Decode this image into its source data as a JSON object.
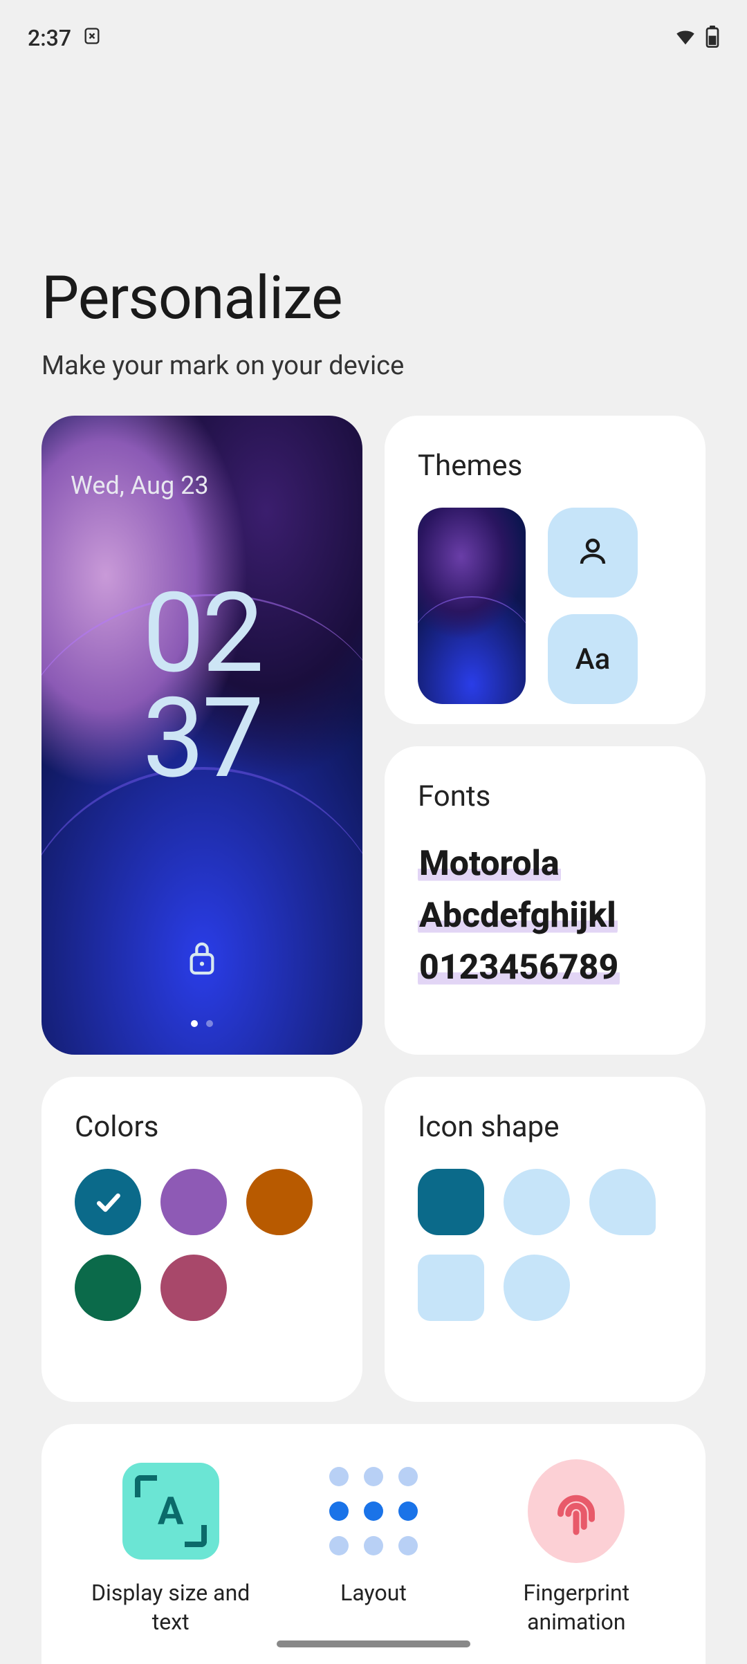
{
  "status": {
    "time": "2:37"
  },
  "header": {
    "title": "Personalize",
    "subtitle": "Make your mark on your device"
  },
  "wallpaper": {
    "date": "Wed, Aug 23",
    "hour": "02",
    "minute": "37"
  },
  "themes": {
    "title": "Themes",
    "aa": "Aa"
  },
  "fonts": {
    "title": "Fonts",
    "line1": "Motorola",
    "line2": "Abcdefghijkl",
    "line3": "0123456789"
  },
  "colors": {
    "title": "Colors",
    "swatches": [
      "#0b6a8a",
      "#8e5ab5",
      "#b85a00",
      "#0b6a4a",
      "#a8486a"
    ],
    "selected_index": 0
  },
  "icon_shape": {
    "title": "Icon shape"
  },
  "bottom": {
    "display_size": "Display size and text",
    "layout": "Layout",
    "fingerprint": "Fingerprint animation"
  }
}
